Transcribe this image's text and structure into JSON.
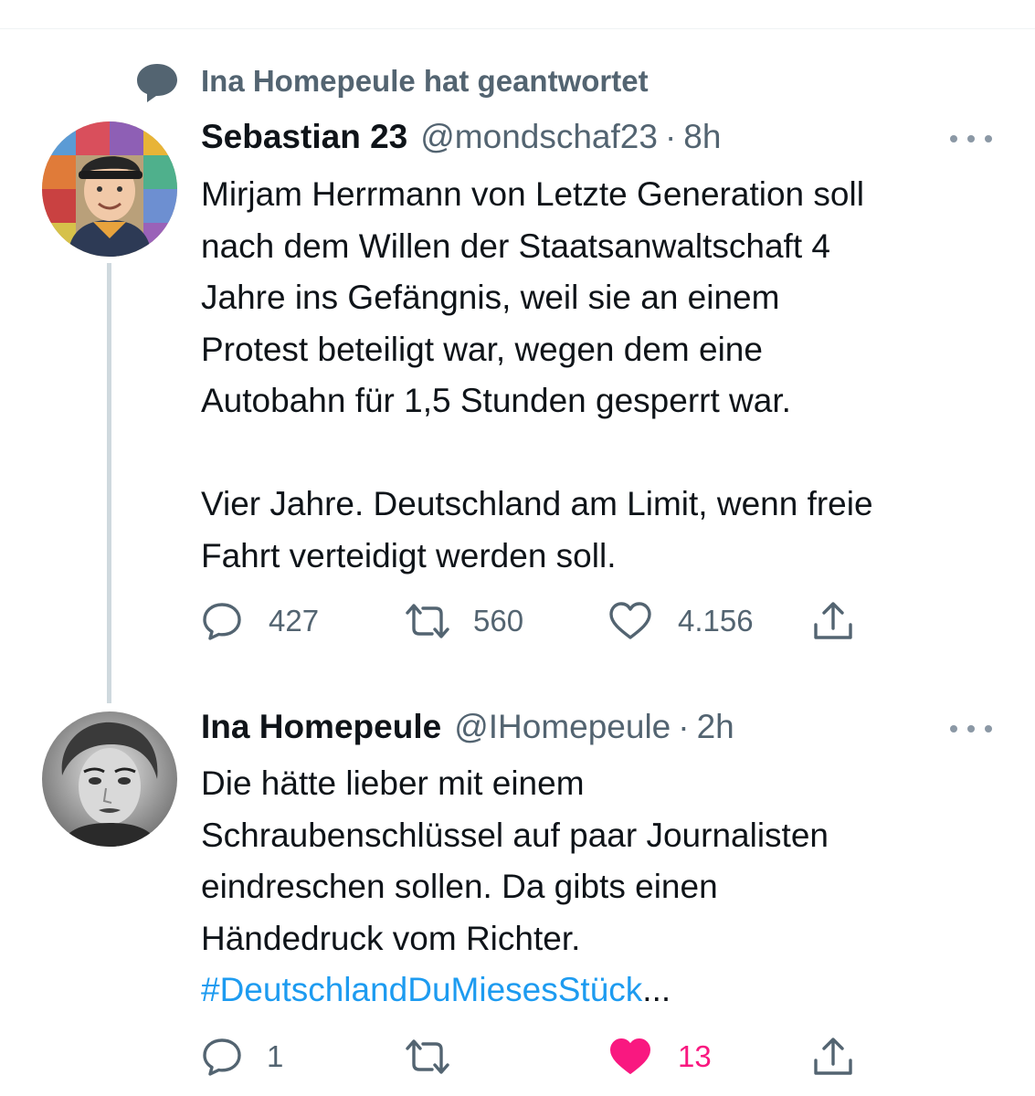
{
  "context": {
    "text": "Ina Homepeule hat geantwortet",
    "icon": "speech-bubble-icon"
  },
  "tweets": [
    {
      "name": "Sebastian 23",
      "handle": "@mondschaf23",
      "separator": "·",
      "time": "8h",
      "text_lines": [
        "Mirjam Herrmann von Letzte Generation soll",
        "nach dem Willen der Staatsanwaltschaft 4",
        "Jahre ins Gefängnis, weil sie an einem",
        "Protest beteiligt war, wegen dem eine",
        "Autobahn für 1,5 Stunden gesperrt war.",
        "",
        "Vier Jahre. Deutschland am Limit, wenn freie",
        "Fahrt verteidigt werden soll."
      ],
      "replies": "427",
      "retweets": "560",
      "likes": "4.156",
      "liked": false
    },
    {
      "name": "Ina Homepeule",
      "handle": "@IHomepeule",
      "separator": "·",
      "time": "2h",
      "text_lines": [
        "Die hätte lieber mit einem",
        "Schraubenschlüssel auf paar Journalisten",
        "eindreschen sollen. Da gibts einen",
        "Händedruck vom Richter."
      ],
      "hashtag": "#DeutschlandDuMiesesStück",
      "truncation": "...",
      "replies": "1",
      "retweets": "",
      "likes": "13",
      "liked": true
    }
  ],
  "colors": {
    "text": "#0f1419",
    "secondary": "#536471",
    "link": "#1d9bf0",
    "like": "#f91880",
    "thread_line": "#cfd9de"
  }
}
